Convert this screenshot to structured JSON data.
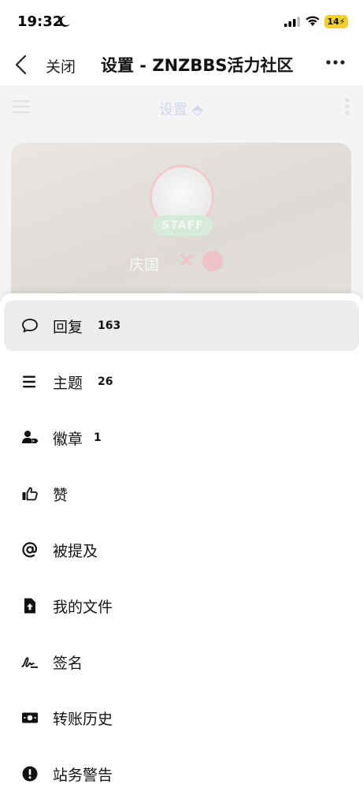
{
  "status_bar": {
    "time": "19:32",
    "battery": "14"
  },
  "nav": {
    "close_label": "关闭",
    "title": "设置 - ZNZBBS活力社区"
  },
  "background": {
    "page_title": "设置 ⬘",
    "staff_label": "STAFF",
    "username": "庆国"
  },
  "menu": [
    {
      "label": "回复",
      "count": "163",
      "icon": "comment-icon",
      "active": true
    },
    {
      "label": "主题",
      "count": "26",
      "icon": "list-icon"
    },
    {
      "label": "徽章",
      "count": "1",
      "icon": "user-tag-icon"
    },
    {
      "label": "赞",
      "icon": "thumbs-up-icon"
    },
    {
      "label": "被提及",
      "icon": "at-icon"
    },
    {
      "label": "我的文件",
      "icon": "file-upload-icon"
    },
    {
      "label": "签名",
      "icon": "signature-icon"
    },
    {
      "label": "转账历史",
      "icon": "money-icon"
    },
    {
      "label": "站务警告",
      "icon": "exclamation-circle-icon"
    }
  ]
}
